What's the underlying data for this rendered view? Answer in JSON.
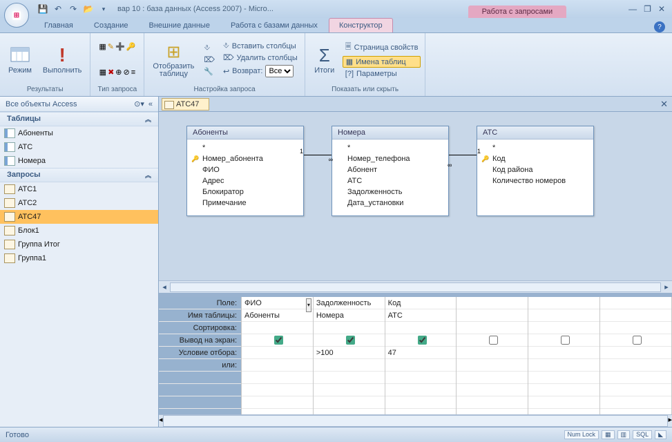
{
  "title": "вар 10 : база данных (Access 2007) - Micro...",
  "context_tab_group": "Работа с запросами",
  "ribbon_tabs": {
    "home": "Главная",
    "create": "Создание",
    "external": "Внешние данные",
    "dbtools": "Работа с базами данных",
    "design": "Конструктор"
  },
  "ribbon": {
    "results": {
      "view": "Режим",
      "run": "Выполнить",
      "label": "Результаты"
    },
    "qtype": {
      "label": "Тип запроса"
    },
    "setup": {
      "showtbl": "Отобразить\nтаблицу",
      "inscol": "Вставить столбцы",
      "delcol": "Удалить столбцы",
      "return": "Возврат:",
      "ret_opts": [
        "Все"
      ],
      "label": "Настройка запроса"
    },
    "totals": {
      "totals": "Итоги",
      "props": "Страница свойств",
      "tblnames": "Имена таблиц",
      "params": "Параметры",
      "label": "Показать или скрыть"
    }
  },
  "nav": {
    "title": "Все объекты Access",
    "cat_tables": "Таблицы",
    "cat_queries": "Запросы",
    "tables": [
      "Абоненты",
      "АТС",
      "Номера"
    ],
    "queries": [
      "АТС1",
      "АТС2",
      "АТС47",
      "Блок1",
      "Группа Итог",
      "Группа1"
    ]
  },
  "doc_tab": "ATC47",
  "diagram": {
    "t1": {
      "title": "Абоненты",
      "star": "*",
      "fields": [
        "Номер_абонента",
        "ФИО",
        "Адрес",
        "Блокиратор",
        "Примечание"
      ]
    },
    "t2": {
      "title": "Номера",
      "star": "*",
      "fields": [
        "Номер_телефона",
        "Абонент",
        "АТС",
        "Задолженность",
        "Дата_установки"
      ]
    },
    "t3": {
      "title": "АТС",
      "star": "*",
      "fields": [
        "Код",
        "Код района",
        "Количество номеров"
      ]
    }
  },
  "qbe": {
    "labels": {
      "field": "Поле:",
      "table": "Имя таблицы:",
      "sort": "Сортировка:",
      "show": "Вывод на экран:",
      "criteria": "Условие отбора:",
      "or": "или:"
    },
    "cols": [
      {
        "field": "ФИО",
        "table": "Абоненты",
        "show": true,
        "criteria": ""
      },
      {
        "field": "Задолженность",
        "table": "Номера",
        "show": true,
        "criteria": ">100"
      },
      {
        "field": "Код",
        "table": "АТС",
        "show": true,
        "criteria": "47"
      },
      {
        "field": "",
        "table": "",
        "show": false,
        "criteria": ""
      },
      {
        "field": "",
        "table": "",
        "show": false,
        "criteria": ""
      },
      {
        "field": "",
        "table": "",
        "show": false,
        "criteria": ""
      }
    ]
  },
  "status": {
    "ready": "Готово",
    "numlock": "Num Lock",
    "sql": "SQL"
  }
}
